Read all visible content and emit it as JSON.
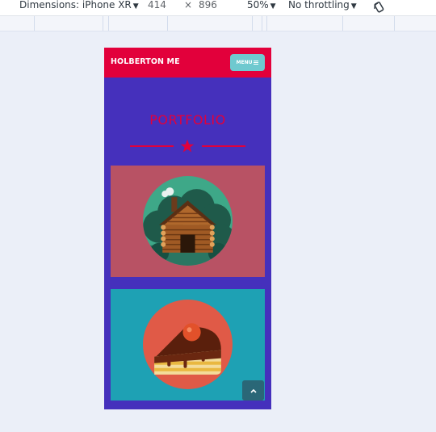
{
  "devtools": {
    "dimensions_label": "Dimensions: iPhone XR",
    "width": "414",
    "times": "×",
    "height": "896",
    "zoom": "50%",
    "throttling": "No throttling"
  },
  "site": {
    "brand": "HOLBERTON ME",
    "menu_label": "MENU",
    "menu_icon": "hamburger-icon",
    "portfolio_title": "PORTFOLIO"
  },
  "portfolio": {
    "items": [
      {
        "name": "log-cabin",
        "background": "#b85264",
        "icon": "cabin-icon"
      },
      {
        "name": "cake-slice",
        "background": "#1ea1b4",
        "icon": "cake-icon"
      }
    ]
  },
  "colors": {
    "header": "#e2003b",
    "page": "#4530bc",
    "menu_button": "#6fc9cf",
    "scroll_top_button": "#2a6777"
  }
}
